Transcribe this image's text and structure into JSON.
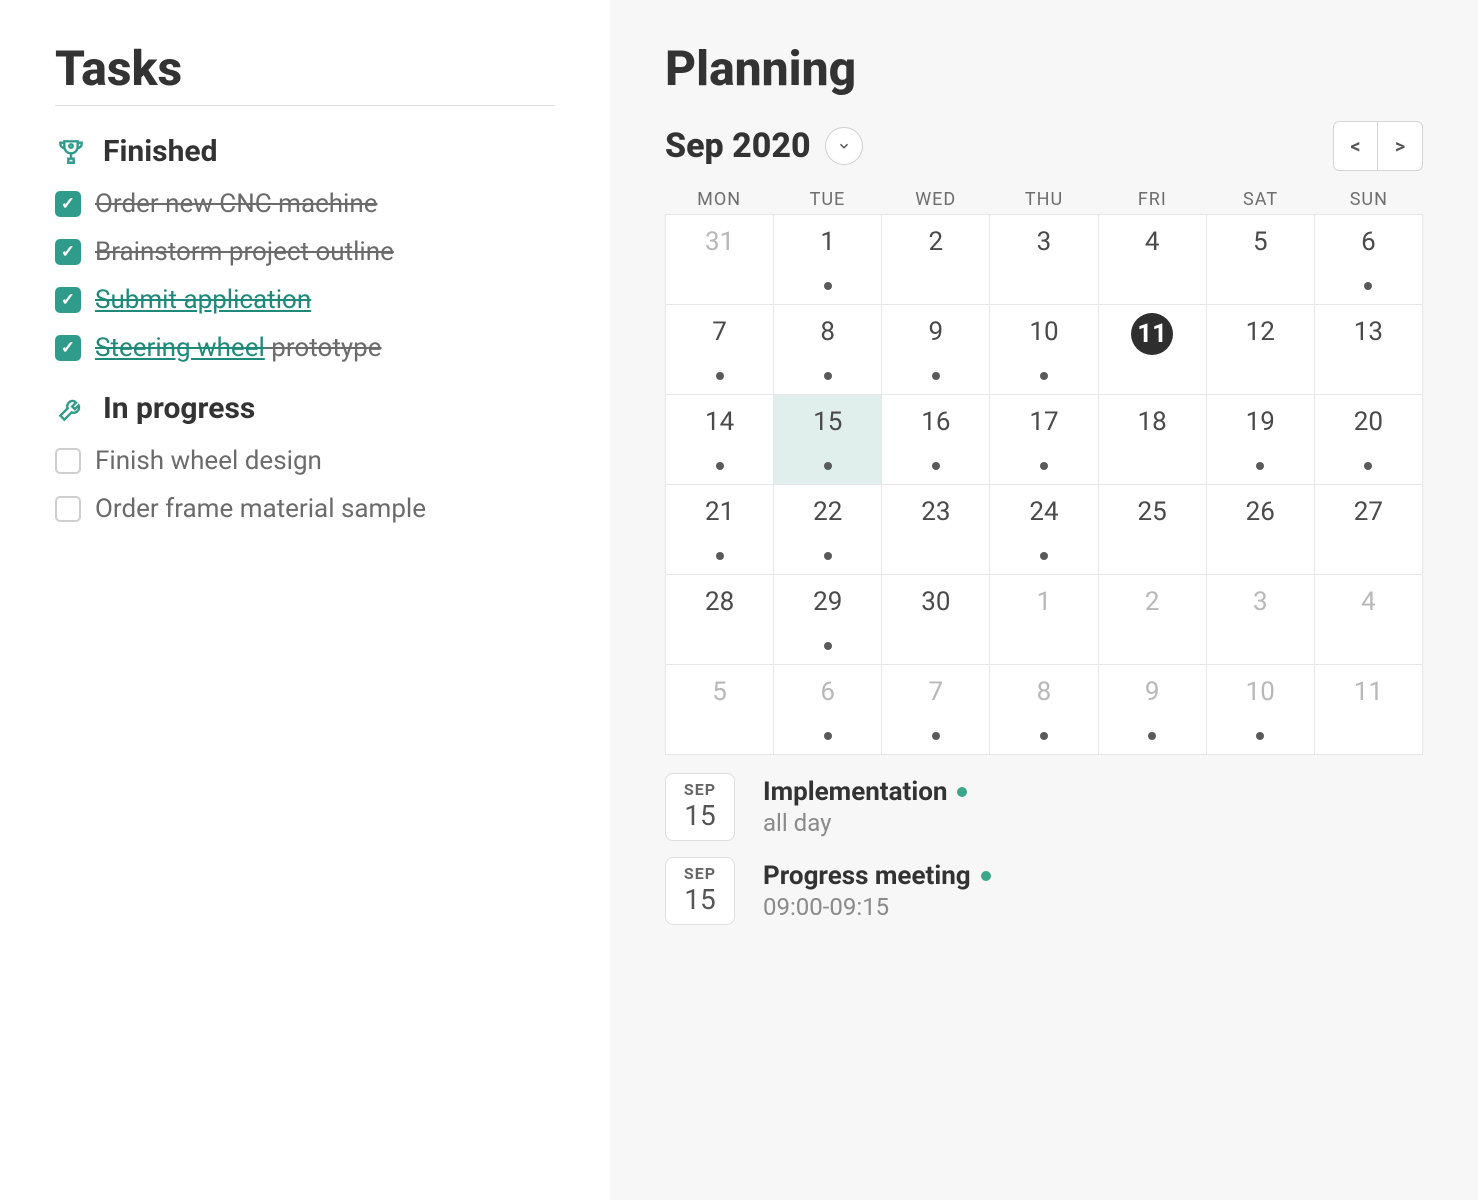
{
  "tasks": {
    "title": "Tasks",
    "sections": {
      "finished": {
        "label": "Finished",
        "items": [
          {
            "text": "Order new CNC machine",
            "checked": true,
            "style": "done"
          },
          {
            "text": "Brainstorm project outline",
            "checked": true,
            "style": "done"
          },
          {
            "text": "Submit application",
            "checked": true,
            "style": "link"
          },
          {
            "link_text": "Steering wheel",
            "plain_text": " prototype",
            "checked": true,
            "style": "mixed"
          }
        ]
      },
      "in_progress": {
        "label": "In progress",
        "items": [
          {
            "text": "Finish wheel design",
            "checked": false
          },
          {
            "text": "Order frame material sample",
            "checked": false
          }
        ]
      }
    }
  },
  "planning": {
    "title": "Planning",
    "month_label": "Sep 2020",
    "prev_arrow": "<",
    "next_arrow": ">",
    "dow": [
      "MON",
      "TUE",
      "WED",
      "THU",
      "FRI",
      "SAT",
      "SUN"
    ],
    "cells": [
      {
        "n": "31",
        "other": true,
        "dot": false
      },
      {
        "n": "1",
        "dot": true
      },
      {
        "n": "2",
        "dot": false
      },
      {
        "n": "3",
        "dot": false
      },
      {
        "n": "4",
        "dot": false
      },
      {
        "n": "5",
        "dot": false
      },
      {
        "n": "6",
        "dot": true
      },
      {
        "n": "7",
        "dot": true
      },
      {
        "n": "8",
        "dot": true
      },
      {
        "n": "9",
        "dot": true
      },
      {
        "n": "10",
        "dot": true
      },
      {
        "n": "11",
        "dot": false,
        "today": true
      },
      {
        "n": "12",
        "dot": false
      },
      {
        "n": "13",
        "dot": false
      },
      {
        "n": "14",
        "dot": true
      },
      {
        "n": "15",
        "dot": true,
        "selected": true
      },
      {
        "n": "16",
        "dot": true
      },
      {
        "n": "17",
        "dot": true
      },
      {
        "n": "18",
        "dot": false
      },
      {
        "n": "19",
        "dot": true
      },
      {
        "n": "20",
        "dot": true
      },
      {
        "n": "21",
        "dot": true
      },
      {
        "n": "22",
        "dot": true
      },
      {
        "n": "23",
        "dot": false
      },
      {
        "n": "24",
        "dot": true
      },
      {
        "n": "25",
        "dot": false
      },
      {
        "n": "26",
        "dot": false
      },
      {
        "n": "27",
        "dot": false
      },
      {
        "n": "28",
        "dot": false
      },
      {
        "n": "29",
        "dot": true
      },
      {
        "n": "30",
        "dot": false
      },
      {
        "n": "1",
        "other": true,
        "dot": false
      },
      {
        "n": "2",
        "other": true,
        "dot": false
      },
      {
        "n": "3",
        "other": true,
        "dot": false
      },
      {
        "n": "4",
        "other": true,
        "dot": false
      },
      {
        "n": "5",
        "other": true,
        "dot": false
      },
      {
        "n": "6",
        "other": true,
        "dot": true
      },
      {
        "n": "7",
        "other": true,
        "dot": true
      },
      {
        "n": "8",
        "other": true,
        "dot": true
      },
      {
        "n": "9",
        "other": true,
        "dot": true
      },
      {
        "n": "10",
        "other": true,
        "dot": true
      },
      {
        "n": "11",
        "other": true,
        "dot": false
      }
    ],
    "events": [
      {
        "month": "SEP",
        "day": "15",
        "title": "Implementation",
        "sub": "all day"
      },
      {
        "month": "SEP",
        "day": "15",
        "title": "Progress meeting",
        "sub": "09:00-09:15"
      }
    ]
  }
}
